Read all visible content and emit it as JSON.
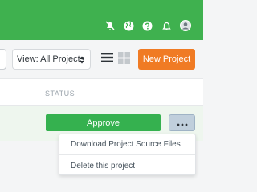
{
  "topbar": {
    "color": "#3fb14f",
    "icons": [
      "notifications-off-icon",
      "globe-icon",
      "help-icon",
      "bell-icon",
      "avatar"
    ]
  },
  "toolbar": {
    "view_select": {
      "label": "View: All Projects"
    },
    "list_view_icon": "list-view-icon",
    "grid_view_icon": "grid-view-icon",
    "new_project_label": "New Project",
    "new_project_color": "#f07b24"
  },
  "table": {
    "status_header": "STATUS"
  },
  "row": {
    "approve_label": "Approve",
    "approve_color": "#35b14f",
    "more_icon": "more-horizontal-icon"
  },
  "menu": {
    "items": [
      "Download Project Source Files",
      "Delete this project"
    ]
  }
}
